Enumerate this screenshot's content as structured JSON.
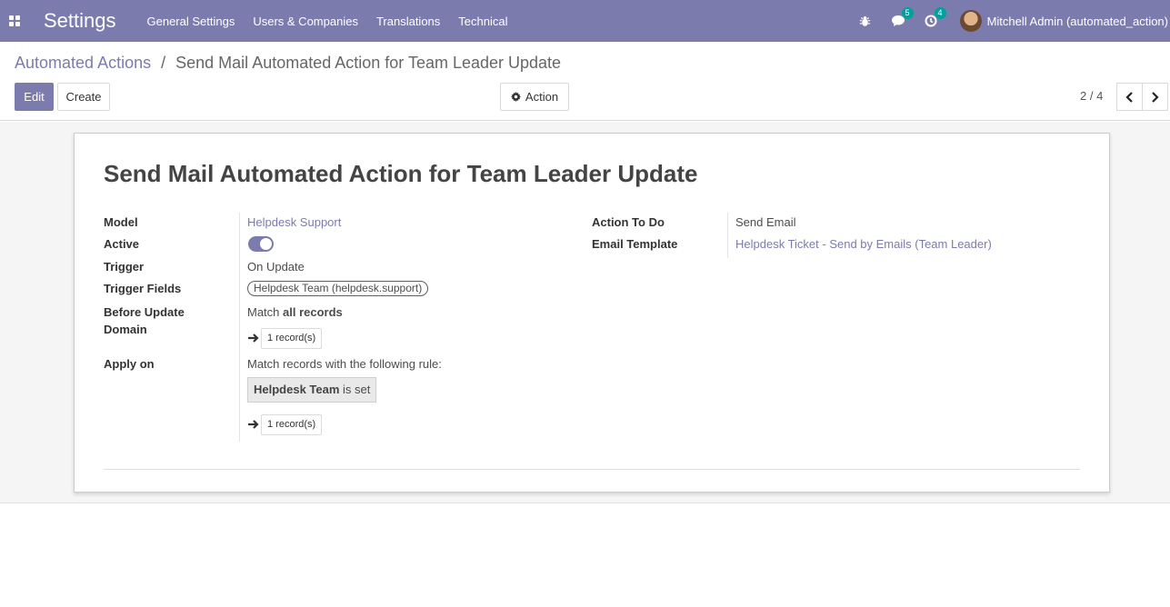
{
  "navbar": {
    "brand": "Settings",
    "menu": [
      "General Settings",
      "Users & Companies",
      "Translations",
      "Technical"
    ],
    "messages_count": "5",
    "activities_count": "4",
    "user_name": "Mitchell Admin (automated_action)",
    "color": "#7c7bad"
  },
  "breadcrumb": {
    "parent": "Automated Actions",
    "separator": "/",
    "current": "Send Mail Automated Action for Team Leader Update"
  },
  "toolbar": {
    "edit_label": "Edit",
    "create_label": "Create",
    "action_label": "Action"
  },
  "pager": {
    "value": "2 / 4"
  },
  "form": {
    "title": "Send Mail Automated Action for Team Leader Update",
    "left": {
      "model_label": "Model",
      "model_value": "Helpdesk Support",
      "active_label": "Active",
      "active_value": true,
      "trigger_label": "Trigger",
      "trigger_value": "On Update",
      "trigger_fields_label": "Trigger Fields",
      "trigger_fields_tag": "Helpdesk Team (helpdesk.support)",
      "before_update_label_1": "Before Update",
      "before_update_label_2": "Domain",
      "before_update_prefix": "Match ",
      "before_update_bold": "all records",
      "before_update_records": "1 record(s)",
      "apply_on_label": "Apply on",
      "apply_on_text": "Match records with the following rule:",
      "rule_field": "Helpdesk Team",
      "rule_operator": "is set",
      "apply_on_records": "1 record(s)"
    },
    "right": {
      "action_label": "Action To Do",
      "action_value": "Send Email",
      "template_label": "Email Template",
      "template_value": "Helpdesk Ticket - Send by Emails (Team Leader)"
    }
  }
}
